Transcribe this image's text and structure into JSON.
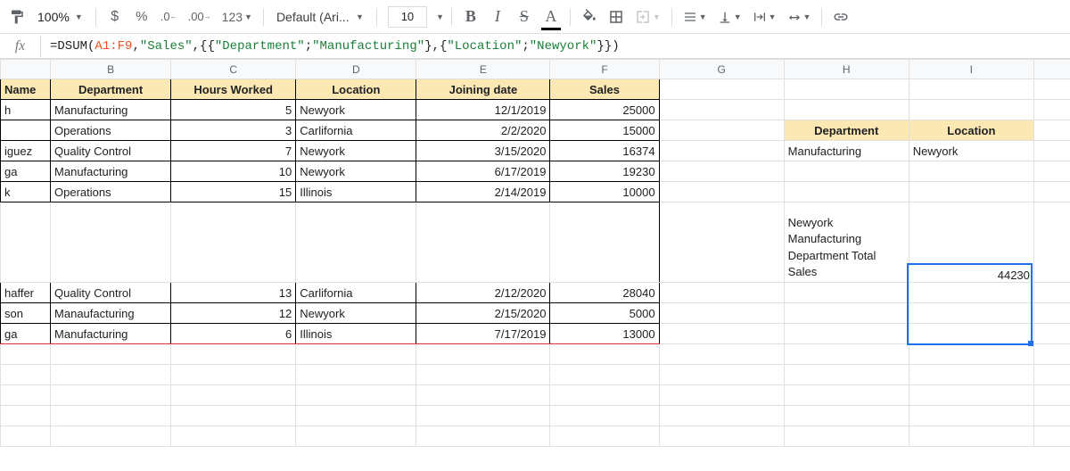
{
  "toolbar": {
    "zoom": "100%",
    "font_name": "Default (Ari...",
    "font_size": "10",
    "fmt_123": "123"
  },
  "formula": {
    "prefix": "=DSUM(",
    "ref": "A1:F9",
    "comma1": ",",
    "str_sales": "\"Sales\"",
    "comma2": ",{{",
    "str_dept": "\"Department\"",
    "semi1": ";",
    "str_mfg": "\"Manufacturing\"",
    "mid": "},{",
    "str_loc": "\"Location\"",
    "semi2": ";",
    "str_ny": "\"Newyork\"",
    "suffix": "}})"
  },
  "columns": [
    "",
    "B",
    "C",
    "D",
    "E",
    "F",
    "G",
    "H",
    "I",
    ""
  ],
  "headers": {
    "a": "Name",
    "b": "Department",
    "c": "Hours Worked",
    "d": "Location",
    "e": "Joining date",
    "f": "Sales"
  },
  "rows": [
    {
      "a": "h",
      "b": "Manufacturing",
      "c": "5",
      "d": "Newyork",
      "e": "12/1/2019",
      "f": "25000"
    },
    {
      "a": "",
      "b": "Operations",
      "c": "3",
      "d": "Carlifornia",
      "e": "2/2/2020",
      "f": "15000"
    },
    {
      "a": "iguez",
      "b": "Quality Control",
      "c": "7",
      "d": "Newyork",
      "e": "3/15/2020",
      "f": "16374"
    },
    {
      "a": "ga",
      "b": "Manufacturing",
      "c": "10",
      "d": "Newyork",
      "e": "6/17/2019",
      "f": "19230"
    },
    {
      "a": "k",
      "b": "Operations",
      "c": "15",
      "d": "Illinois",
      "e": "2/14/2019",
      "f": "10000"
    }
  ],
  "rows2": [
    {
      "a": "haffer",
      "b": "Quality Control",
      "c": "13",
      "d": "Carlifornia",
      "e": "2/12/2020",
      "f": "28040"
    },
    {
      "a": "son",
      "b": "Manaufacturing",
      "c": "12",
      "d": "Newyork",
      "e": "2/15/2020",
      "f": "5000"
    },
    {
      "a": "ga",
      "b": "Manufacturing",
      "c": "6",
      "d": "Illinois",
      "e": "7/17/2019",
      "f": "13000"
    }
  ],
  "criteria": {
    "dept_h": "Department",
    "loc_h": "Location",
    "dept_v": "Manufacturing",
    "loc_v": "Newyork"
  },
  "result": {
    "label": "Newyork Manufacturing Department Total Sales",
    "value": "44230"
  },
  "chart_data": null
}
